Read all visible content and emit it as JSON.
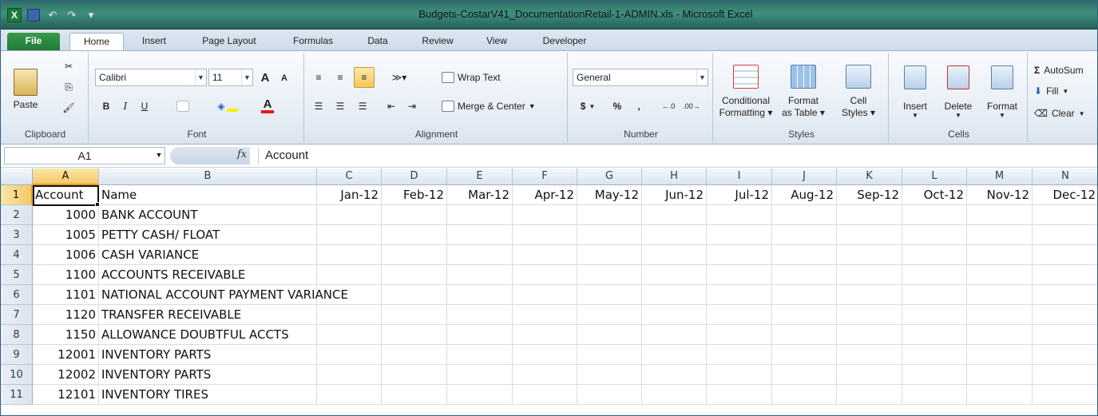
{
  "window": {
    "title": "Budgets-CostarV41_DocumentationRetail-1-ADMIN.xls  -  Microsoft Excel"
  },
  "ribbon_tabs": [
    "File",
    "Home",
    "Insert",
    "Page Layout",
    "Formulas",
    "Data",
    "Review",
    "View",
    "Developer"
  ],
  "clipboard": {
    "paste": "Paste",
    "label": "Clipboard"
  },
  "font": {
    "name": "Calibri",
    "size": "11",
    "label": "Font",
    "bold": "B",
    "italic": "I",
    "underline": "U",
    "grow": "A",
    "shrink": "A",
    "font_color": "A"
  },
  "alignment": {
    "wrap": "Wrap Text",
    "merge": "Merge & Center",
    "label": "Alignment"
  },
  "number": {
    "format": "General",
    "currency": "$",
    "percent": "%",
    "comma": ",",
    "inc": ".0 .00",
    "label": "Number"
  },
  "styles": {
    "conditional_1": "Conditional",
    "conditional_2": "Formatting",
    "table_1": "Format",
    "table_2": "as Table",
    "cell_1": "Cell",
    "cell_2": "Styles",
    "label": "Styles"
  },
  "cells_group": {
    "insert": "Insert",
    "delete": "Delete",
    "format": "Format",
    "label": "Cells"
  },
  "editing": {
    "autosum": "AutoSum",
    "fill": "Fill",
    "clear": "Clear"
  },
  "formula_bar": {
    "name_box": "A1",
    "fx": "fx",
    "value": "Account"
  },
  "columns": [
    "A",
    "B",
    "C",
    "D",
    "E",
    "F",
    "G",
    "H",
    "I",
    "J",
    "K",
    "L",
    "M",
    "N"
  ],
  "header_row": [
    "Account",
    "Name",
    "Jan-12",
    "Feb-12",
    "Mar-12",
    "Apr-12",
    "May-12",
    "Jun-12",
    "Jul-12",
    "Aug-12",
    "Sep-12",
    "Oct-12",
    "Nov-12",
    "Dec-12"
  ],
  "rows": [
    {
      "num": "2",
      "account": "1000",
      "name": "BANK ACCOUNT"
    },
    {
      "num": "3",
      "account": "1005",
      "name": "PETTY CASH/ FLOAT"
    },
    {
      "num": "4",
      "account": "1006",
      "name": "CASH VARIANCE"
    },
    {
      "num": "5",
      "account": "1100",
      "name": "ACCOUNTS RECEIVABLE"
    },
    {
      "num": "6",
      "account": "1101",
      "name": "NATIONAL ACCOUNT PAYMENT VARIANCE"
    },
    {
      "num": "7",
      "account": "1120",
      "name": "TRANSFER RECEIVABLE"
    },
    {
      "num": "8",
      "account": "1150",
      "name": "ALLOWANCE DOUBTFUL ACCTS"
    },
    {
      "num": "9",
      "account": "12001",
      "name": "INVENTORY PARTS"
    },
    {
      "num": "10",
      "account": "12002",
      "name": "INVENTORY PARTS"
    },
    {
      "num": "11",
      "account": "12101",
      "name": "INVENTORY TIRES"
    }
  ]
}
